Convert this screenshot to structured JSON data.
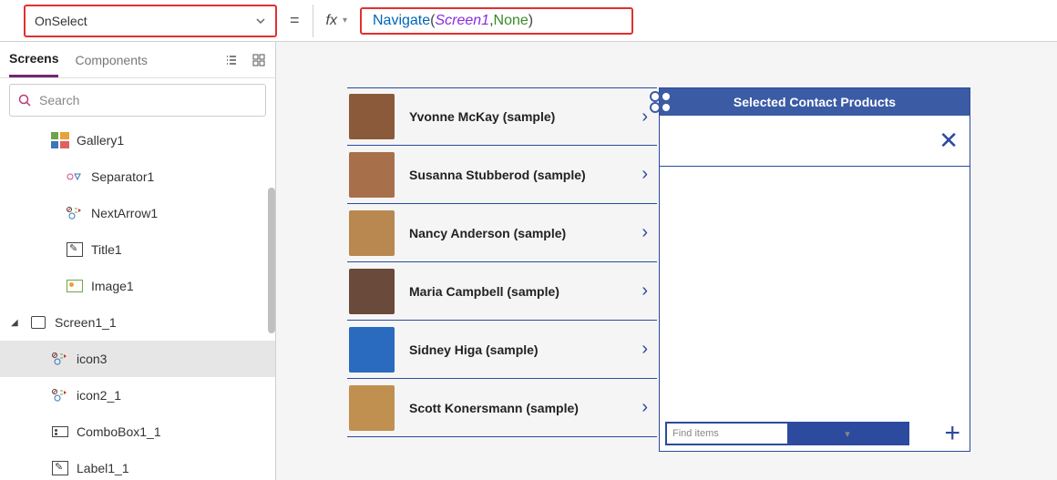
{
  "formula_bar": {
    "property": "OnSelect",
    "fx_label": "fx",
    "fn_name": "Navigate",
    "paren_open": "( ",
    "arg1": "Screen1",
    "comma": ", ",
    "arg2": "None",
    "paren_close": " )",
    "equals": "="
  },
  "tabs": {
    "screens": "Screens",
    "components": "Components"
  },
  "search": {
    "placeholder": "Search"
  },
  "tree": {
    "gallery1": "Gallery1",
    "separator1": "Separator1",
    "nextarrow1": "NextArrow1",
    "title1": "Title1",
    "image1": "Image1",
    "screen1_1": "Screen1_1",
    "icon3": "icon3",
    "icon2_1": "icon2_1",
    "combobox1_1": "ComboBox1_1",
    "label1_1": "Label1_1"
  },
  "gallery": {
    "rows": [
      {
        "name": "Yvonne McKay (sample)",
        "color": "#8a5a3b"
      },
      {
        "name": "Susanna Stubberod (sample)",
        "color": "#a8704a"
      },
      {
        "name": "Nancy Anderson (sample)",
        "color": "#b88850"
      },
      {
        "name": "Maria Campbell (sample)",
        "color": "#6a4a3a"
      },
      {
        "name": "Sidney Higa (sample)",
        "color": "#2a6abf"
      },
      {
        "name": "Scott Konersmann (sample)",
        "color": "#c09050"
      }
    ]
  },
  "right_panel": {
    "title": "Selected Contact Products",
    "combo_placeholder": "Find items"
  }
}
